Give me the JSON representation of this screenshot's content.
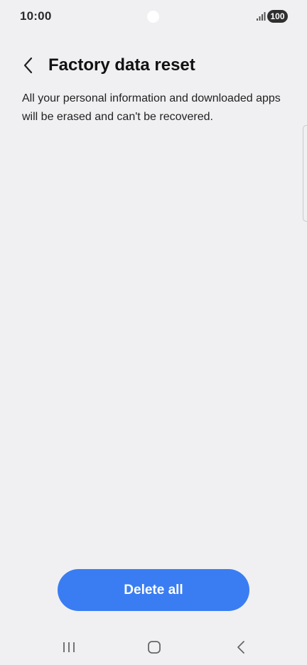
{
  "status_bar": {
    "time": "10:00",
    "battery": "100",
    "icons": [
      "signal-icon",
      "battery-icon",
      "camera-cutout"
    ]
  },
  "header": {
    "title": "Factory data reset",
    "back_icon": "chevron-left-icon"
  },
  "content": {
    "description": "All your personal information and downloaded apps will be erased and can't be recovered."
  },
  "actions": {
    "delete_label": "Delete all"
  },
  "nav_bar": {
    "items": [
      "recent-apps-icon",
      "home-icon",
      "back-icon"
    ]
  },
  "colors": {
    "background": "#f0f0f3",
    "accent": "#3a7df2",
    "text": "#111111"
  }
}
